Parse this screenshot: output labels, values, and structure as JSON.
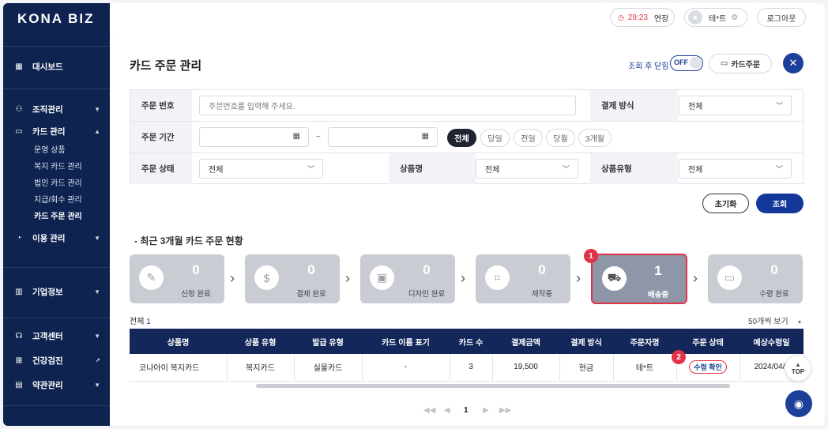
{
  "sidebar": {
    "logo": "KONA BIZ",
    "dashboard": "대시보드",
    "org": "조직관리",
    "card": "카드 관리",
    "card_sub": [
      "운영 상품",
      "복지 카드 관리",
      "법인 카드 관리",
      "지급/회수 관리",
      "카드 주문 관리"
    ],
    "usage": "이용 관리",
    "company": "기업정보",
    "support": "고객센터",
    "health": "건강검진",
    "terms": "약관관리"
  },
  "topbar": {
    "timer": "29:23",
    "extend": "연장",
    "user": "테*트",
    "logout": "로그아웃"
  },
  "page": {
    "title": "카드 주문 관리",
    "close_after_query": "조회 후 닫힘",
    "toggle_state": "OFF",
    "card_order_btn": "카드주문"
  },
  "filters": {
    "order_no_label": "주문 번호",
    "order_no_placeholder": "주문번호를 입력해 주세요.",
    "payment_method_label": "결제 방식",
    "payment_method_value": "전체",
    "order_period_label": "주문 기간",
    "tilde": "~",
    "period_chips": [
      "전체",
      "당일",
      "전일",
      "당월",
      "3개월"
    ],
    "order_status_label": "주문 상태",
    "order_status_value": "전체",
    "product_name_label": "상품명",
    "product_name_value": "전체",
    "product_type_label": "상품유형",
    "product_type_value": "전체",
    "reset": "초기화",
    "search": "조회"
  },
  "status": {
    "title": "- 최근 3개월 카드 주문 현황",
    "steps": [
      {
        "label": "신청 완료",
        "count": "0"
      },
      {
        "label": "결제 완료",
        "count": "0"
      },
      {
        "label": "디자인 완료",
        "count": "0"
      },
      {
        "label": "제작중",
        "count": "0"
      },
      {
        "label": "배송중",
        "count": "1"
      },
      {
        "label": "수령 완료",
        "count": "0"
      }
    ],
    "annotation_1": "1",
    "annotation_2": "2"
  },
  "list": {
    "total_label": "전체",
    "total_count": "1",
    "page_size": "50개씩 보기",
    "columns": [
      "상품명",
      "상품 유형",
      "발급 유형",
      "카드 이름 표기",
      "카드 수",
      "결제금액",
      "결제 방식",
      "주문자명",
      "주문 상태",
      "예상수령일"
    ],
    "rows": [
      [
        "코나아이 복지카드",
        "복지카드",
        "실물카드",
        "-",
        "3",
        "19,500",
        "현금",
        "테*트",
        "수령 확인",
        "2024/04/3"
      ]
    ],
    "page_current": "1",
    "top_btn": "TOP"
  },
  "colors": {
    "navy": "#0f2350",
    "header_navy": "#13275a",
    "accent_red": "#e13247",
    "button_blue": "#1c3f9a"
  }
}
